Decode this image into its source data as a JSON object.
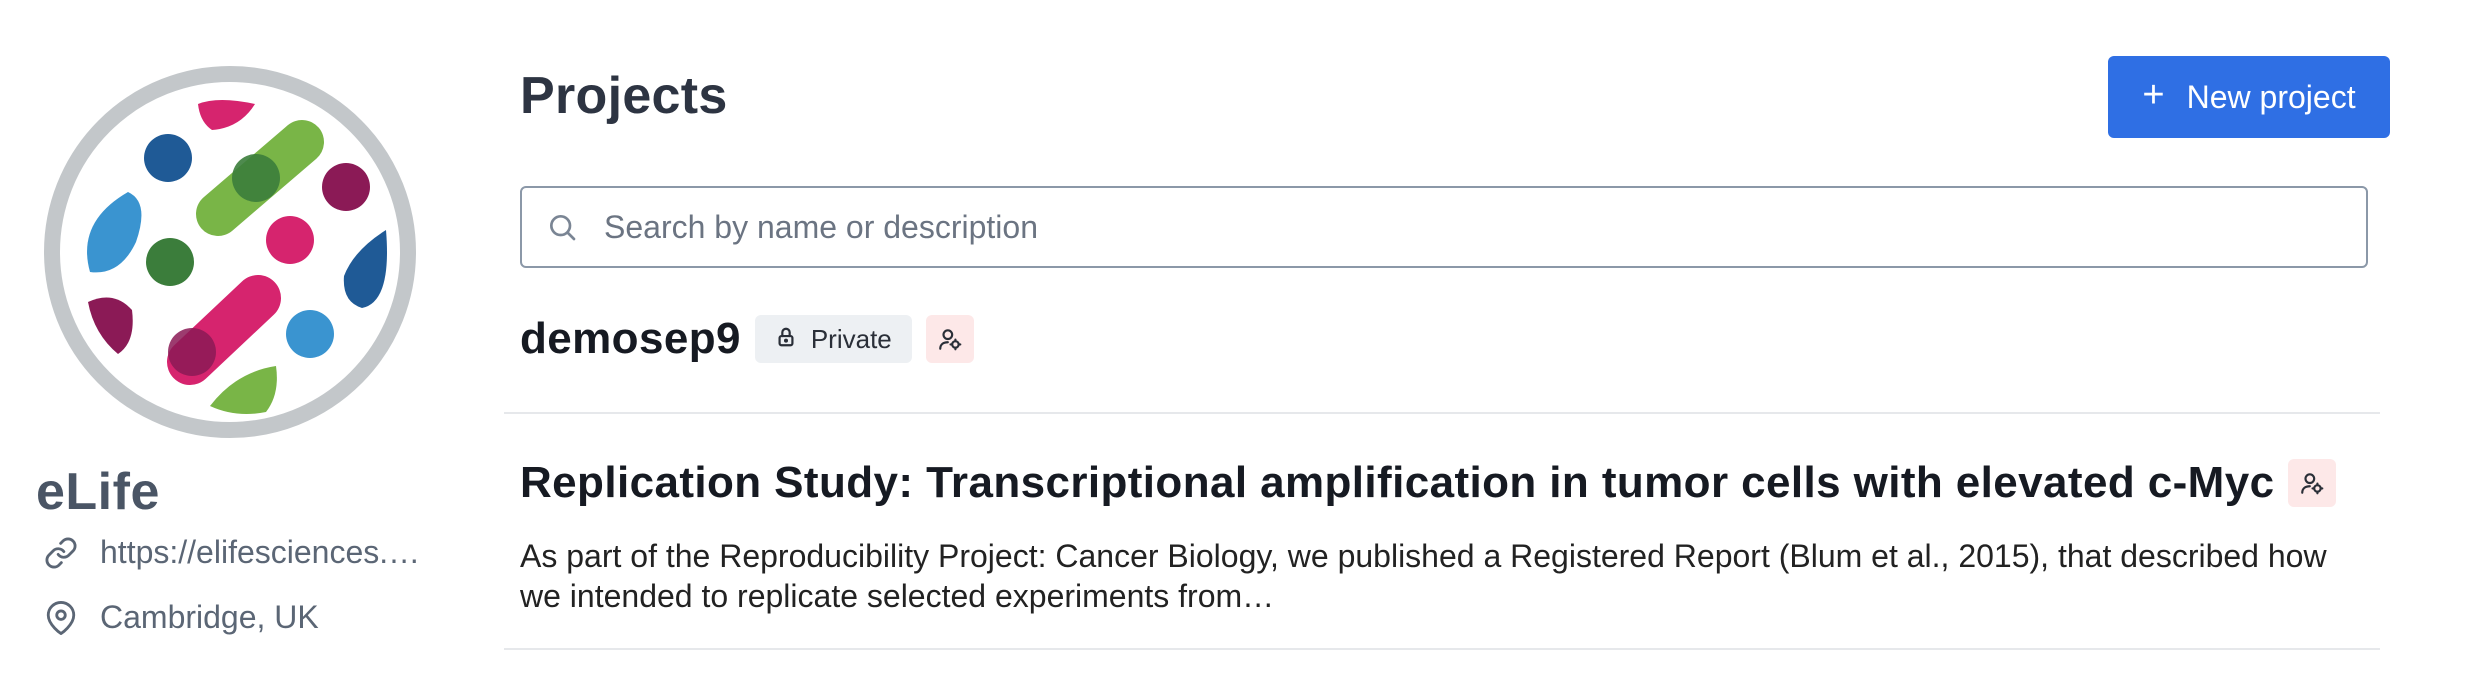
{
  "org": {
    "name": "eLife",
    "website": "https://elifesciences.o…",
    "location": "Cambridge, UK",
    "logo_icon": "elife-logo"
  },
  "main": {
    "title": "Projects",
    "new_project_label": "New project",
    "search_placeholder": "Search by name or description"
  },
  "projects": [
    {
      "title": "demosep9",
      "visibility": "Private",
      "role_icon": "user-gear-icon",
      "description": ""
    },
    {
      "title": "Replication Study: Transcriptional amplification in tumor cells with elevated c-Myc",
      "role_icon": "user-gear-icon",
      "description": "As part of the Reproducibility Project: Cancer Biology, we published a Registered Report (Blum et al., 2015), that described how we intended to replicate selected experiments from…"
    }
  ],
  "colors": {
    "accent": "#2f6fe4",
    "owner_badge_bg": "#fde8e8",
    "private_badge_bg": "#edf0f3"
  }
}
